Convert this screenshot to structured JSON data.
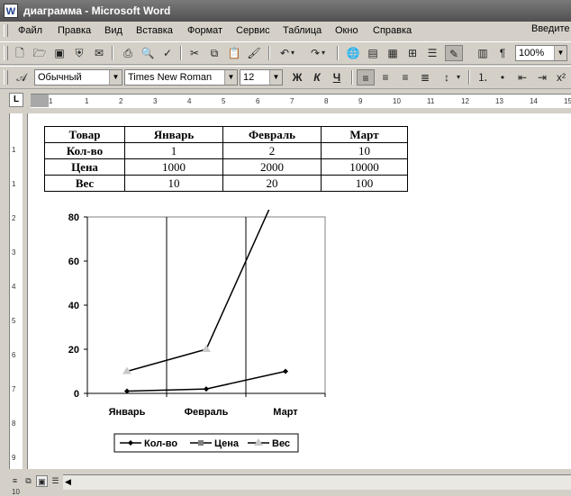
{
  "window": {
    "title": "диаграмма - Microsoft Word",
    "app_icon": "W"
  },
  "menu": {
    "items": [
      "Файл",
      "Правка",
      "Вид",
      "Вставка",
      "Формат",
      "Сервис",
      "Таблица",
      "Окно",
      "Справка"
    ],
    "help_placeholder": "Введите"
  },
  "toolbar": {
    "zoom": "100%",
    "pilcrow": "¶"
  },
  "formatting": {
    "style": "Обычный",
    "font": "Times New Roman",
    "size": "12",
    "bold": "Ж",
    "italic": "К",
    "underline": "Ч"
  },
  "ruler": {
    "corner": "L",
    "h_labels": [
      "1",
      "1",
      "2",
      "3",
      "4",
      "5",
      "6",
      "7",
      "8",
      "9",
      "10",
      "11",
      "12",
      "13",
      "14",
      "15"
    ],
    "v_labels": [
      "1",
      "1",
      "2",
      "3",
      "4",
      "5",
      "6",
      "7",
      "8",
      "9",
      "10"
    ]
  },
  "table": {
    "header": [
      "Товар",
      "Январь",
      "Февраль",
      "Март"
    ],
    "rows": [
      [
        "Кол-во",
        "1",
        "2",
        "10"
      ],
      [
        "Цена",
        "1000",
        "2000",
        "10000"
      ],
      [
        "Вес",
        "10",
        "20",
        "100"
      ]
    ]
  },
  "chart_data": {
    "type": "line",
    "categories": [
      "Январь",
      "Февраль",
      "Март"
    ],
    "series": [
      {
        "name": "Кол-во",
        "values": [
          1,
          2,
          10
        ],
        "marker": "diamond",
        "color": "#000000"
      },
      {
        "name": "Цена",
        "values": [
          1000,
          2000,
          10000
        ],
        "marker": "square",
        "color": "#808080"
      },
      {
        "name": "Вес",
        "values": [
          10,
          20,
          100
        ],
        "marker": "triangle",
        "color": "#c8c8c8"
      }
    ],
    "ylim": [
      0,
      80
    ],
    "yticks": [
      0,
      20,
      40,
      60,
      80
    ],
    "legend": "bottom"
  },
  "colors": {
    "titlebar": "#6b6b6b",
    "chrome": "#d4d0c8"
  }
}
